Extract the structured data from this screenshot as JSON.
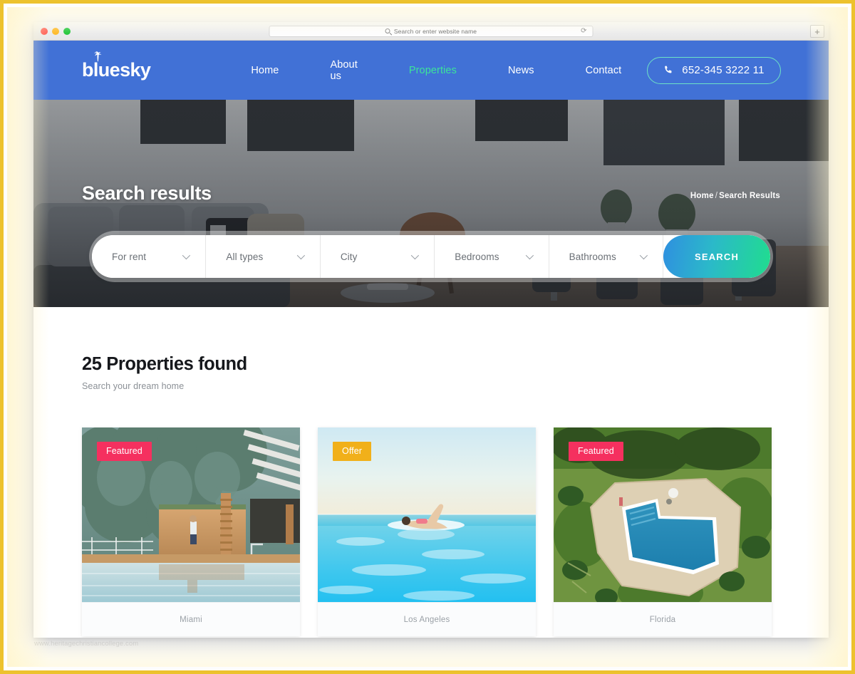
{
  "browser": {
    "traffic_lights": [
      "close",
      "minimize",
      "zoom"
    ],
    "address_placeholder": "Search or enter website name",
    "address_value": "",
    "reload_label": "⟳",
    "new_tab_label": "+"
  },
  "header": {
    "logo": "bluesky",
    "nav": [
      {
        "label": "Home",
        "active": false
      },
      {
        "label": "About us",
        "active": false
      },
      {
        "label": "Properties",
        "active": true
      },
      {
        "label": "News",
        "active": false
      },
      {
        "label": "Contact",
        "active": false
      }
    ],
    "phone": "652-345 3222 11"
  },
  "hero": {
    "title": "Search results",
    "breadcrumb": {
      "home": "Home",
      "separator": "/",
      "current": "Search Results"
    }
  },
  "search_form": {
    "fields": [
      {
        "name": "listing-type",
        "value": "For rent"
      },
      {
        "name": "property-type",
        "value": "All types"
      },
      {
        "name": "city",
        "value": "City"
      },
      {
        "name": "bedrooms",
        "value": "Bedrooms"
      },
      {
        "name": "bathrooms",
        "value": "Bathrooms"
      }
    ],
    "submit_label": "SEARCH"
  },
  "results": {
    "title": "25 Properties found",
    "subtitle": "Search your dream home",
    "count": 25,
    "cards": [
      {
        "badge": "Featured",
        "badge_kind": "featured",
        "city": "Miami"
      },
      {
        "badge": "Offer",
        "badge_kind": "offer",
        "city": "Los Angeles"
      },
      {
        "badge": "Featured",
        "badge_kind": "featured",
        "city": "Florida"
      }
    ]
  },
  "watermark": "www.heritagechristiancollege.com",
  "colors": {
    "header_blue": "#4171d6",
    "accent_green": "#3ce49a",
    "badge_featured": "#f5305f",
    "badge_offer": "#f1b01a",
    "frame_gold": "#edc22e"
  }
}
